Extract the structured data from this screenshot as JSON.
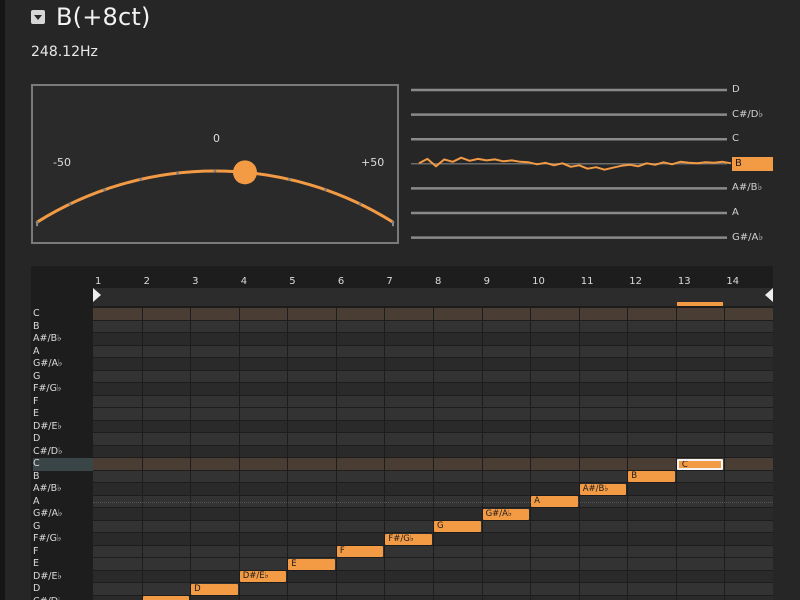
{
  "header": {
    "title": "B(+8ct)",
    "frequency": "248.12Hz",
    "collapse_icon": "triangle-down-icon"
  },
  "tuner": {
    "labels": {
      "center": "0",
      "left": "-50",
      "right": "+50"
    },
    "cents": 8,
    "range": [
      -50,
      50
    ],
    "accent": "#f39a45"
  },
  "pitch_history": {
    "notes": [
      "D",
      "C#/D♭",
      "C",
      "B",
      "A#/B♭",
      "A",
      "G#/A♭"
    ],
    "active": "B",
    "trace_cents": [
      2,
      20,
      -10,
      18,
      8,
      25,
      12,
      20,
      14,
      18,
      10,
      14,
      8,
      6,
      -2,
      4,
      -6,
      2,
      -12,
      -6,
      -20,
      -14,
      -24,
      -16,
      -8,
      -4,
      -10,
      2,
      -4,
      6,
      -2,
      8,
      4,
      2,
      6,
      4,
      8,
      2
    ]
  },
  "piano_roll": {
    "bar_numbers": [
      "1",
      "2",
      "3",
      "4",
      "5",
      "6",
      "7",
      "8",
      "9",
      "10",
      "11",
      "12",
      "13",
      "14"
    ],
    "key_labels": [
      "C",
      "B",
      "A#/B♭",
      "A",
      "G#/A♭",
      "G",
      "F#/G♭",
      "F",
      "E",
      "D#/E♭",
      "D",
      "C#/D♭",
      "C",
      "B",
      "A#/B♭",
      "A",
      "G#/A♭",
      "G",
      "F#/G♭",
      "F",
      "E",
      "D#/E♭",
      "D",
      "C#/D♭"
    ],
    "highlight_rows": [
      0,
      12
    ],
    "active_key_row": 12,
    "notes": [
      {
        "label": "",
        "row": 23,
        "bar": 2
      },
      {
        "label": "D",
        "row": 22,
        "bar": 3
      },
      {
        "label": "D#/E♭",
        "row": 21,
        "bar": 4
      },
      {
        "label": "E",
        "row": 20,
        "bar": 5
      },
      {
        "label": "F",
        "row": 19,
        "bar": 6
      },
      {
        "label": "F#/G♭",
        "row": 18,
        "bar": 7
      },
      {
        "label": "G",
        "row": 17,
        "bar": 8
      },
      {
        "label": "G#/A♭",
        "row": 16,
        "bar": 9
      },
      {
        "label": "A",
        "row": 15,
        "bar": 10
      },
      {
        "label": "A#/B♭",
        "row": 14,
        "bar": 11
      },
      {
        "label": "B",
        "row": 13,
        "bar": 12
      },
      {
        "label": "C",
        "row": 12,
        "bar": 13,
        "selected": true
      }
    ],
    "loop_bar": 13
  }
}
